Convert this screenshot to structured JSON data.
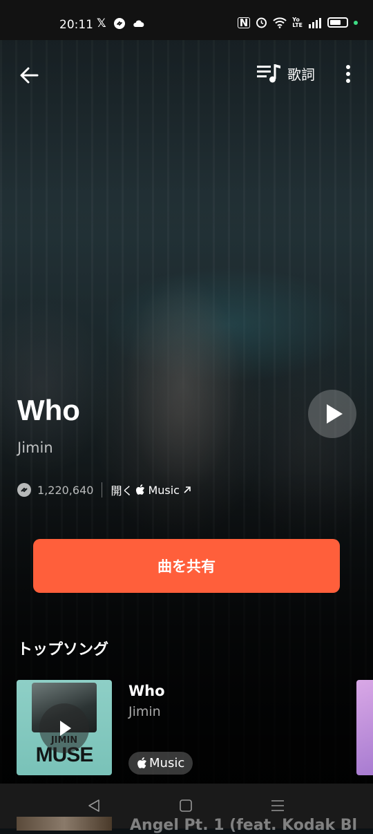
{
  "status_bar": {
    "time": "20:11",
    "left_icons": [
      "x-icon",
      "shazam-icon",
      "cloud-icon"
    ],
    "right_icons": [
      "nfc-icon",
      "alarm-icon",
      "wifi-icon",
      "volte-icon",
      "signal-icon",
      "battery-icon"
    ]
  },
  "header": {
    "lyrics_label": "歌詞"
  },
  "song": {
    "title": "Who",
    "artist": "Jimin",
    "shazam_count": "1,220,640",
    "open_label": "開く",
    "apple_music_label": "Music"
  },
  "share_button": "曲を共有",
  "top_songs": {
    "heading": "トップソング",
    "items": [
      {
        "title": "Who",
        "artist": "Jimin",
        "album_art_text": "MUSE",
        "album_art_artist": "JIMIN",
        "badge": "Music"
      }
    ]
  },
  "peek_next": {
    "title": "Angel Pt. 1 (feat. Kodak Bl"
  },
  "colors": {
    "accent": "#ff5f3b",
    "background": "#0c1114"
  }
}
